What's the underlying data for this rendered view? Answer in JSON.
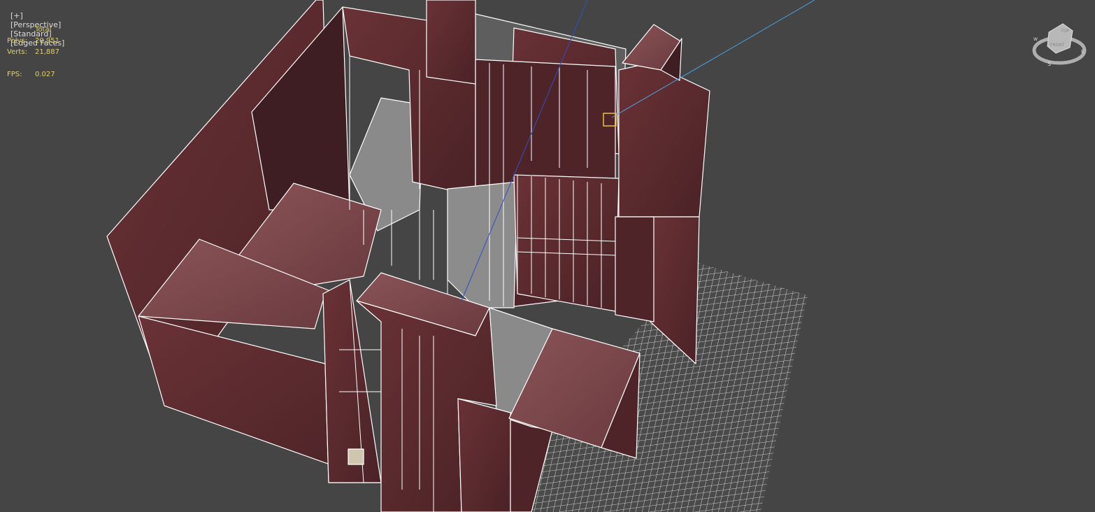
{
  "viewport_labels": {
    "menu": "[+]",
    "view": "[Perspective]",
    "shading": "[Standard]",
    "edges": "[Edged Faces]"
  },
  "stats": {
    "header": "Total",
    "polys_label": "Polys:",
    "polys": "20,951",
    "verts_label": "Verts:",
    "verts": "21,887",
    "fps_label": "FPS:",
    "fps": "0.027"
  },
  "viewcube": {
    "top": "TOP",
    "front": "FRONT",
    "compass": {
      "s": "S",
      "e": "E",
      "w": "W"
    }
  },
  "colors": {
    "background": "#454545",
    "wall": "#5a2a2e",
    "edge": "#ffffff",
    "stats_text": "#e0d070",
    "selection": "#e8c040",
    "camera_line": "#4aa0e0"
  }
}
